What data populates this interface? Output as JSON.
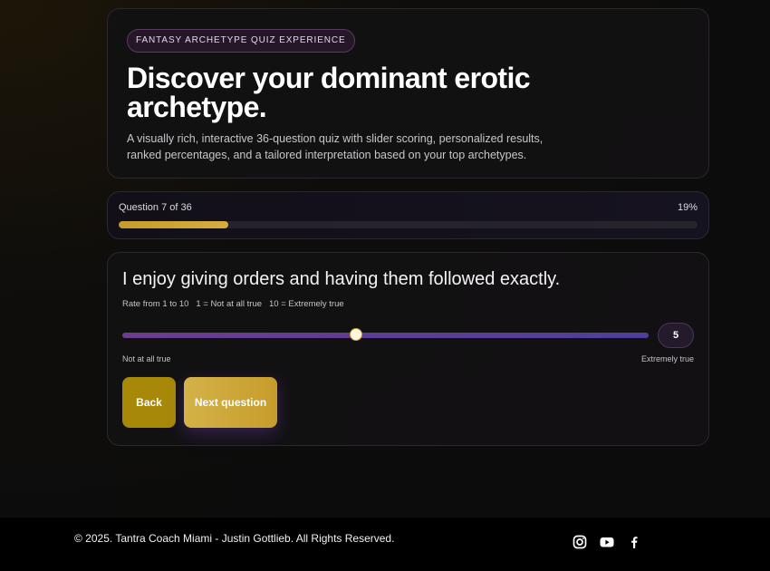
{
  "hero": {
    "badge": "Fantasy Archetype Quiz Experience",
    "title": "Discover your dominant erotic archetype.",
    "description": "A visually rich, interactive 36-question quiz with slider scoring, personalized results, ranked percentages, and a tailored interpretation based on your top archetypes."
  },
  "progress": {
    "label": "Question 7 of 36",
    "percent_label": "19%",
    "fraction": 0.19
  },
  "question": {
    "text": "I enjoy giving orders and having them followed exactly.",
    "rate_hint": "Rate from 1 to 10",
    "scale_low_hint": "1 = Not at all true",
    "scale_high_hint": "10 = Extremely true",
    "min": 1,
    "max": 10,
    "value": 5,
    "value_label": "5",
    "low_label": "Not at all true",
    "high_label": "Extremely true",
    "back_label": "Back",
    "next_label": "Next question"
  },
  "footer": {
    "copyright": "© 2025. Tantra Coach Miami - Justin Gottlieb. All Rights Reserved.",
    "social_icons": [
      "instagram-icon",
      "youtube-icon",
      "facebook-icon"
    ]
  },
  "colors": {
    "accent_gold": "#c59b2a",
    "slider_purple": "#6d3c8e",
    "background": "#0c0c0c"
  }
}
